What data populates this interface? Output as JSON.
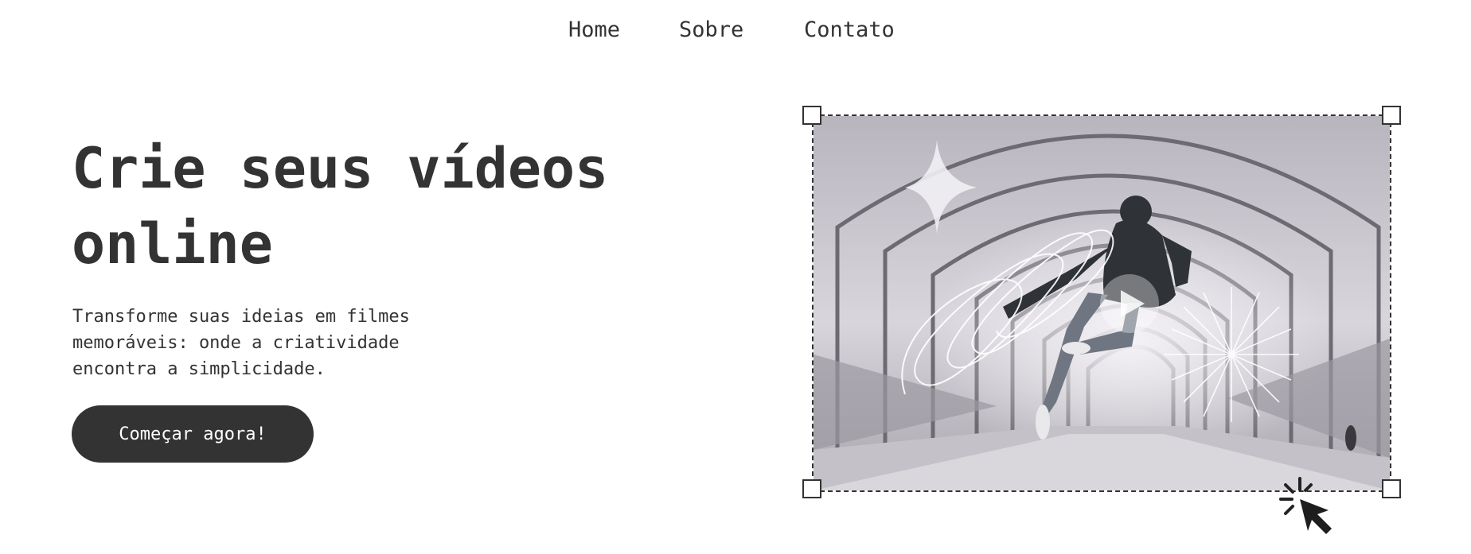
{
  "nav": {
    "items": [
      {
        "label": "Home"
      },
      {
        "label": "Sobre"
      },
      {
        "label": "Contato"
      }
    ]
  },
  "hero": {
    "title_line1": "Crie seus vídeos",
    "title_line2": "online",
    "description": "Transforme suas ideias em filmes memoráveis: onde a criatividade encontra a simplicidade.",
    "cta_label": "Começar agora!"
  },
  "media": {
    "icons": [
      "sparkle-icon",
      "scribble-icon",
      "play-icon",
      "starburst-icon",
      "click-cursor-icon"
    ]
  },
  "colors": {
    "text": "#333333",
    "button_bg": "#333333",
    "button_text": "#ffffff",
    "background": "#ffffff"
  }
}
